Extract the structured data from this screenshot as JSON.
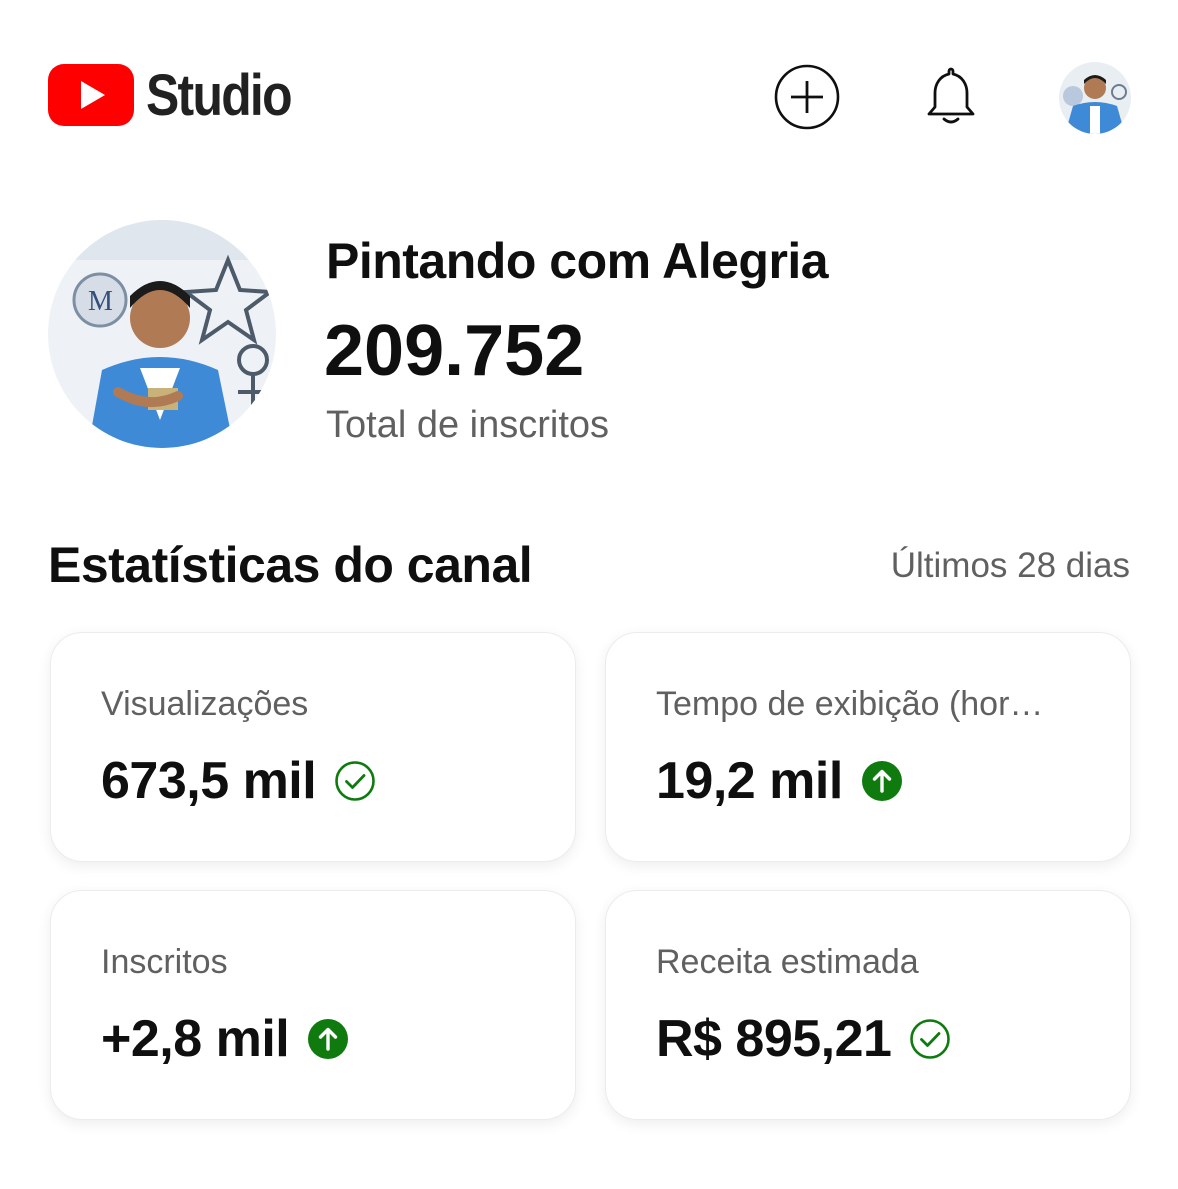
{
  "header": {
    "logo_text": "Studio",
    "brand_color": "#ff0000",
    "icons": [
      "create-icon",
      "bell-icon",
      "account-avatar"
    ]
  },
  "channel": {
    "name": "Pintando com Alegria",
    "subscriber_count": "209.752",
    "subscriber_label": "Total de inscritos"
  },
  "stats": {
    "title": "Estatísticas do canal",
    "period": "Últimos 28 dias",
    "cards": [
      {
        "label": "Visualizações",
        "value": "673,5 mil",
        "status_icon": "check-circle-icon"
      },
      {
        "label": "Tempo de exibição (hor…",
        "value": "19,2 mil",
        "status_icon": "arrow-up-circle-icon"
      },
      {
        "label": "Inscritos",
        "value": "+2,8 mil",
        "status_icon": "arrow-up-circle-icon"
      },
      {
        "label": "Receita estimada",
        "value": "R$ 895,21",
        "status_icon": "check-circle-icon"
      }
    ],
    "status_color": "#0f7b0f"
  }
}
